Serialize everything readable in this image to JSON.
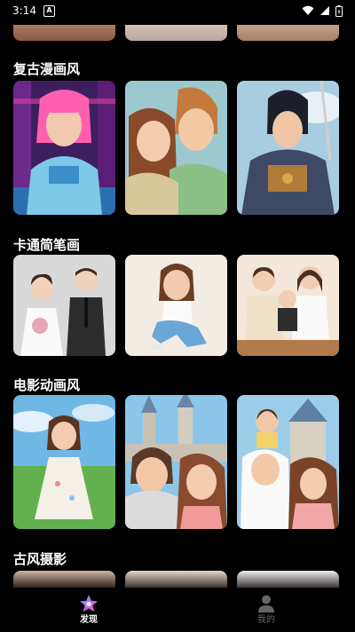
{
  "status_bar": {
    "time": "3:14",
    "notification_icon": "A"
  },
  "sections": [
    {
      "title": "复古漫画风",
      "cards": [
        "retro-cyberpunk-girl",
        "retro-couple",
        "retro-samurai"
      ]
    },
    {
      "title": "卡通简笔画",
      "cards": [
        "cartoon-wedding-couple",
        "cartoon-sitting-girl",
        "cartoon-family"
      ]
    },
    {
      "title": "电影动画风",
      "cards": [
        "animation-girl-meadow",
        "animation-couple-castle",
        "animation-family-castle"
      ]
    },
    {
      "title": "古风摄影",
      "cards": [
        "ancient-portrait-1",
        "ancient-portrait-2",
        "ancient-portrait-3"
      ]
    }
  ],
  "bottom_nav": [
    {
      "label": "发现",
      "icon": "star-icon",
      "active": true
    },
    {
      "label": "我的",
      "icon": "person-icon",
      "active": false
    }
  ],
  "colors": {
    "background": "#000000",
    "active": "#ffffff",
    "inactive": "#666666"
  }
}
